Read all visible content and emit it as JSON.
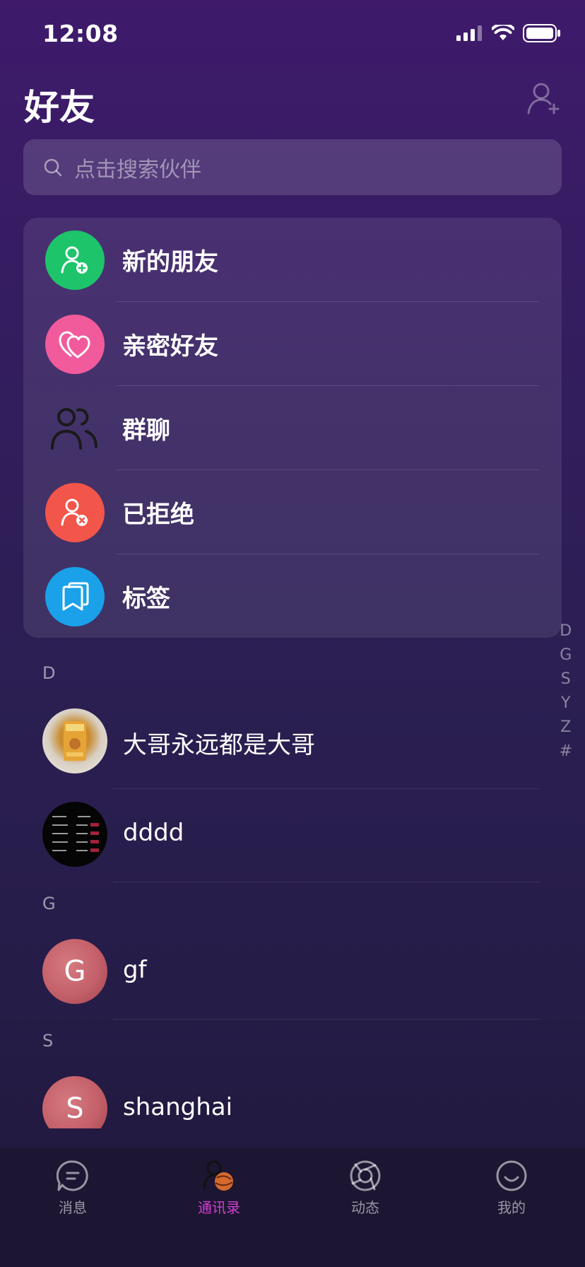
{
  "status": {
    "time": "12:08"
  },
  "header": {
    "title": "好友"
  },
  "search": {
    "placeholder": "点击搜索伙伴"
  },
  "menu": [
    {
      "label": "新的朋友",
      "icon": "add-user-icon",
      "color": "#1ec46a"
    },
    {
      "label": "亲密好友",
      "icon": "heart-icon",
      "color": "#f15b9c"
    },
    {
      "label": "群聊",
      "icon": "group-icon",
      "color": "transparent"
    },
    {
      "label": "已拒绝",
      "icon": "rejected-user-icon",
      "color": "#f2554a"
    },
    {
      "label": "标签",
      "icon": "tag-icon",
      "color": "#1aa1ea"
    }
  ],
  "sections": [
    {
      "letter": "D",
      "contacts": [
        {
          "name": "大哥永远都是大哥"
        },
        {
          "name": "dddd"
        }
      ]
    },
    {
      "letter": "G",
      "contacts": [
        {
          "name": "gf",
          "initial": "G"
        }
      ]
    },
    {
      "letter": "S",
      "contacts": [
        {
          "name": "shanghai",
          "initial": "S"
        }
      ]
    }
  ],
  "index": [
    "D",
    "G",
    "S",
    "Y",
    "Z",
    "#"
  ],
  "tabs": [
    {
      "label": "消息"
    },
    {
      "label": "通讯录",
      "active": true
    },
    {
      "label": "动态"
    },
    {
      "label": "我的"
    }
  ],
  "colors": {
    "active_tab": "#d23fd1",
    "avatar_letter_bg": "#c46069"
  }
}
